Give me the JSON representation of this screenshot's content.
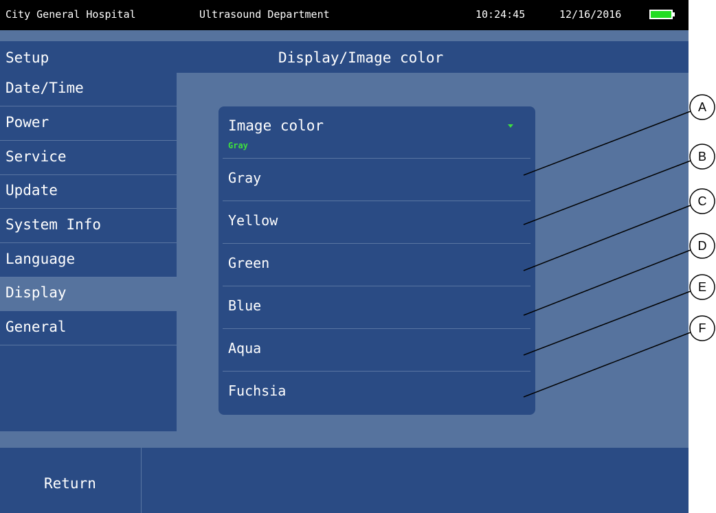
{
  "statusbar": {
    "hospital": "City General Hospital",
    "department": "Ultrasound Department",
    "time": "10:24:45",
    "date": "12/16/2016",
    "battery_icon": "battery-full-icon",
    "battery_color": "#22dd22"
  },
  "header": {
    "section": "Setup",
    "title": "Display/Image color"
  },
  "sidebar": {
    "items": [
      {
        "label": "Date/Time"
      },
      {
        "label": "Power"
      },
      {
        "label": "Service"
      },
      {
        "label": "Update"
      },
      {
        "label": "System Info"
      },
      {
        "label": "Language"
      },
      {
        "label": "Display",
        "active": true
      },
      {
        "label": "General"
      }
    ]
  },
  "dropdown": {
    "label": "Image color",
    "selected": "Gray",
    "caret_icon": "caret-down-icon",
    "options": [
      {
        "label": "Gray",
        "callout": "A"
      },
      {
        "label": "Yellow",
        "callout": "B"
      },
      {
        "label": "Green",
        "callout": "C"
      },
      {
        "label": "Blue",
        "callout": "D"
      },
      {
        "label": "Aqua",
        "callout": "E"
      },
      {
        "label": "Fuchsia",
        "callout": "F"
      }
    ]
  },
  "footer": {
    "return_label": "Return"
  },
  "colors": {
    "background": "#56739e",
    "panel": "#2a4b84",
    "accent_green": "#3ee03e",
    "statusbar": "#000000"
  }
}
